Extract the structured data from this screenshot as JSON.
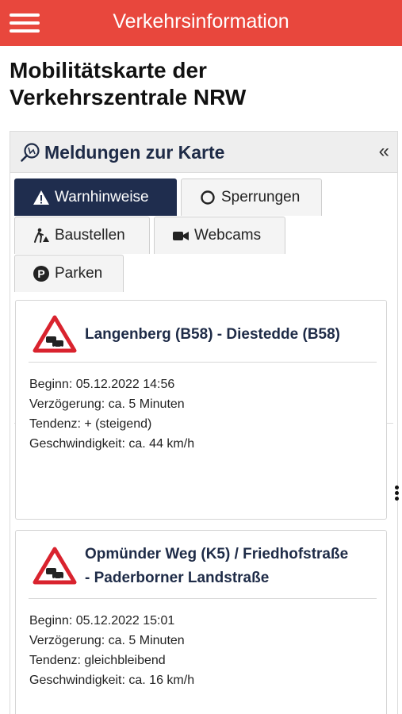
{
  "topbar": {
    "title": "Verkehrsinformation",
    "color": "#e8473d"
  },
  "page": {
    "title": "Mobilitätskarte der Verkehrszentrale NRW"
  },
  "panel": {
    "title": "Meldungen zur Karte",
    "collapse_glyph": "«"
  },
  "tabs": [
    {
      "label": "Warnhinweise",
      "icon": "warning-icon",
      "active": true
    },
    {
      "label": "Sperrungen",
      "icon": "circle-icon",
      "active": false
    },
    {
      "label": "Baustellen",
      "icon": "roadwork-icon",
      "active": false
    },
    {
      "label": "Webcams",
      "icon": "camera-icon",
      "active": false
    },
    {
      "label": "Parken",
      "icon": "parking-icon",
      "active": false
    }
  ],
  "cards": [
    {
      "title": "Langenberg (B58) - Diestedde (B58)",
      "icon": "traffic-jam-warning-icon",
      "details": [
        "Beginn: 05.12.2022 14:56",
        "Verzögerung: ca. 5 Minuten",
        "Tendenz: + (steigend)",
        "Geschwindigkeit: ca. 44 km/h"
      ]
    },
    {
      "title_line1": "Opmünder Weg (K5) / Friedhofstraße",
      "title_line2": "- Paderborner Landstraße",
      "icon": "traffic-jam-warning-icon",
      "details": [
        "Beginn: 05.12.2022 15:01",
        "Verzögerung: ca. 5 Minuten",
        "Tendenz: gleichbleibend",
        "Geschwindigkeit: ca. 16 km/h"
      ]
    }
  ],
  "colors": {
    "accent": "#e8473d",
    "navy": "#1f2d4e",
    "warning_red": "#d9232e"
  }
}
